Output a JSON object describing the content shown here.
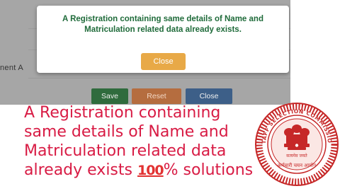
{
  "screen": {
    "partial_label": "nent A",
    "modal": {
      "message": "A Registration containing same details of Name and Matriculation related data already exists.",
      "close_label": "Close"
    },
    "buttons": {
      "save": "Save",
      "reset": "Reset",
      "close": "Close"
    }
  },
  "caption": {
    "line1": "A Registration containing",
    "line2": "same details of Name and",
    "line3": "Matriculation related data",
    "line4_text": "already exists ",
    "line4_emoji": "100",
    "line4_suffix": "% solutions"
  },
  "emblem": {
    "ring_text": "STAFF SELECTION COMMISSION",
    "hindi_text": "कर्मचारी चयन आयोग",
    "motto": "सत्यमेव जयते"
  },
  "colors": {
    "caption": "#d81b44",
    "modal_text": "#1f6b3a",
    "modal_button": "#e8a947",
    "emblem_red": "#c62828"
  }
}
